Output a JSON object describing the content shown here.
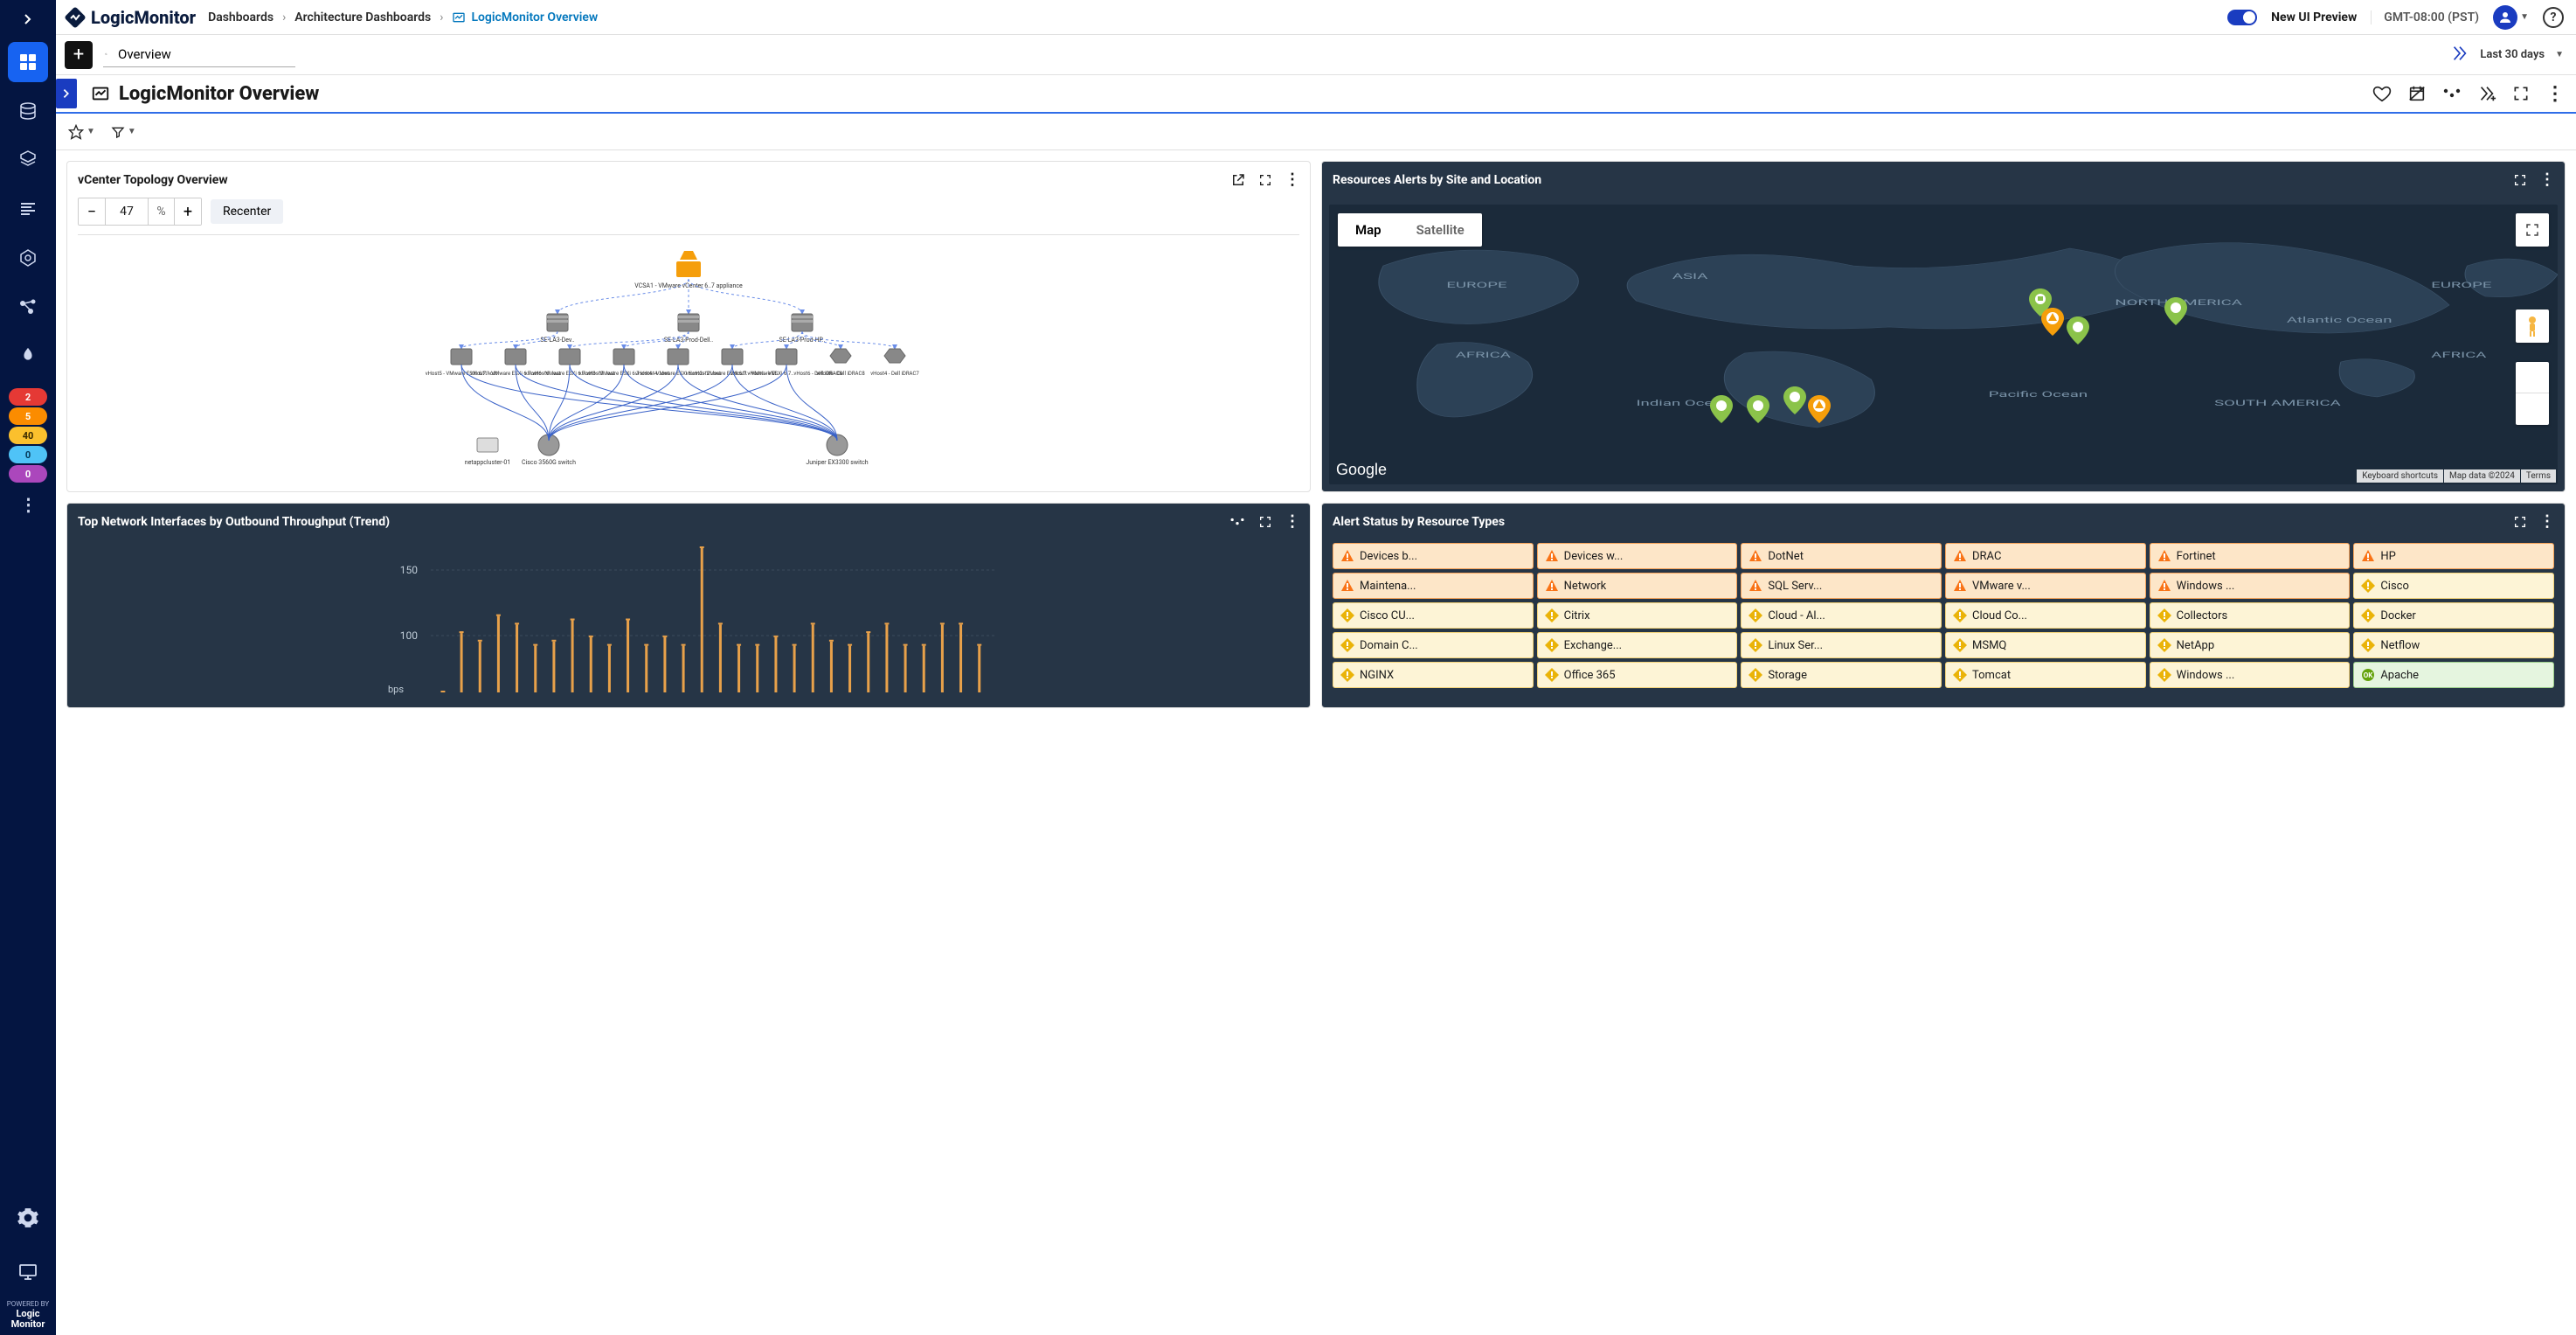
{
  "brand": "LogicMonitor",
  "breadcrumbs": {
    "root": "Dashboards",
    "level1": "Architecture Dashboards",
    "current": "LogicMonitor Overview"
  },
  "ui_preview_label": "New UI Preview",
  "timezone": "GMT-08:00 (PST)",
  "search": {
    "value": "Overview"
  },
  "time_range": "Last 30 days",
  "page_title": "LogicMonitor Overview",
  "alert_counts": {
    "critical": "2",
    "error": "5",
    "warning": "40",
    "info": "0",
    "other": "0"
  },
  "powered_by": {
    "prefix": "POWERED BY",
    "name": "Logic",
    "name2": "Monitor"
  },
  "widgets": {
    "topology": {
      "title": "vCenter Topology Overview",
      "zoom": "47",
      "recenter": "Recenter",
      "nodes": {
        "root": "VCSA1 - VMware vCenter 6..7 appliance",
        "tier1": [
          "SE-LA3-Dev..",
          "SE-LA3-Prod-Dell..",
          "SE-LA3-Prod-HP.."
        ],
        "tier2": [
          "vHost5 - VMware ESXi 6.7.host",
          "vHost1 - VMware ESXi 6.7.vHost6 ..ost",
          "vHost6 - VMware ESXi 6.7.vHost3 ..ost",
          "vHost3 - VMware ESXi 6.7.vHost4 ..ost",
          "vHost4 - VMware ESXi 6.vHost2 ..ost",
          "vHost2 - VMware ESXi 6.7.vHost1 - VM..",
          "vHost1 - VMware ESXi 6.7..vHost6 - Dell iDRAC8",
          "vHost6 - Dell iDRAC8",
          "vHost4 - Dell iDRAC7"
        ],
        "switches": [
          "netappcluster-01",
          "Cisco 3560G switch",
          "Juniper EX3300 switch"
        ]
      }
    },
    "map": {
      "title": "Resources Alerts by Site and Location",
      "tab_map": "Map",
      "tab_sat": "Satellite",
      "labels": [
        "EUROPE",
        "ASIA",
        "NORTH AMERICA",
        "Atlantic Ocean",
        "AFRICA",
        "AFRICA",
        "SOUTH AMERICA",
        "Indian Ocean",
        "Pacific Ocean",
        "EUROPE"
      ],
      "footer": {
        "shortcuts": "Keyboard shortcuts",
        "data": "Map data ©2024",
        "terms": "Terms"
      },
      "logo": "Google"
    },
    "trend": {
      "title": "Top Network Interfaces by Outbound Throughput (Trend)",
      "yticks": [
        "150",
        "100"
      ],
      "yunit": "bps"
    },
    "alertgrid": {
      "title": "Alert Status by Resource Types",
      "cells": [
        {
          "label": "Devices b...",
          "sev": "orange"
        },
        {
          "label": "Devices w...",
          "sev": "orange"
        },
        {
          "label": "DotNet",
          "sev": "orange"
        },
        {
          "label": "DRAC",
          "sev": "orange"
        },
        {
          "label": "Fortinet",
          "sev": "orange"
        },
        {
          "label": "HP",
          "sev": "orange"
        },
        {
          "label": "Maintena...",
          "sev": "orange"
        },
        {
          "label": "Network",
          "sev": "orange"
        },
        {
          "label": "SQL Serv...",
          "sev": "orange"
        },
        {
          "label": "VMware v...",
          "sev": "orange"
        },
        {
          "label": "Windows ...",
          "sev": "orange"
        },
        {
          "label": "Cisco",
          "sev": "yellow"
        },
        {
          "label": "Cisco CU...",
          "sev": "yellow"
        },
        {
          "label": "Citrix",
          "sev": "yellow"
        },
        {
          "label": "Cloud - Al...",
          "sev": "yellow"
        },
        {
          "label": "Cloud Co...",
          "sev": "yellow"
        },
        {
          "label": "Collectors",
          "sev": "yellow"
        },
        {
          "label": "Docker",
          "sev": "yellow"
        },
        {
          "label": "Domain C...",
          "sev": "yellow"
        },
        {
          "label": "Exchange...",
          "sev": "yellow"
        },
        {
          "label": "Linux Ser...",
          "sev": "yellow"
        },
        {
          "label": "MSMQ",
          "sev": "yellow"
        },
        {
          "label": "NetApp",
          "sev": "yellow"
        },
        {
          "label": "Netflow",
          "sev": "yellow"
        },
        {
          "label": "NGINX",
          "sev": "yellow"
        },
        {
          "label": "Office 365",
          "sev": "yellow"
        },
        {
          "label": "Storage",
          "sev": "yellow"
        },
        {
          "label": "Tomcat",
          "sev": "yellow"
        },
        {
          "label": "Windows ...",
          "sev": "yellow"
        },
        {
          "label": "Apache",
          "sev": "green"
        }
      ]
    }
  },
  "chart_data": {
    "type": "bar",
    "title": "Top Network Interfaces by Outbound Throughput (Trend)",
    "ylabel": "bps",
    "ylim": [
      0,
      170
    ],
    "x": [
      1,
      2,
      3,
      4,
      5,
      6,
      7,
      8,
      9,
      10,
      11,
      12,
      13,
      14,
      15,
      16,
      17,
      18,
      19,
      20,
      21,
      22,
      23,
      24,
      25,
      26,
      27,
      28,
      29,
      30
    ],
    "values": [
      0,
      70,
      60,
      90,
      80,
      55,
      60,
      85,
      65,
      55,
      85,
      55,
      65,
      55,
      170,
      80,
      55,
      55,
      65,
      55,
      80,
      60,
      55,
      70,
      80,
      55,
      55,
      80,
      80,
      55
    ]
  }
}
